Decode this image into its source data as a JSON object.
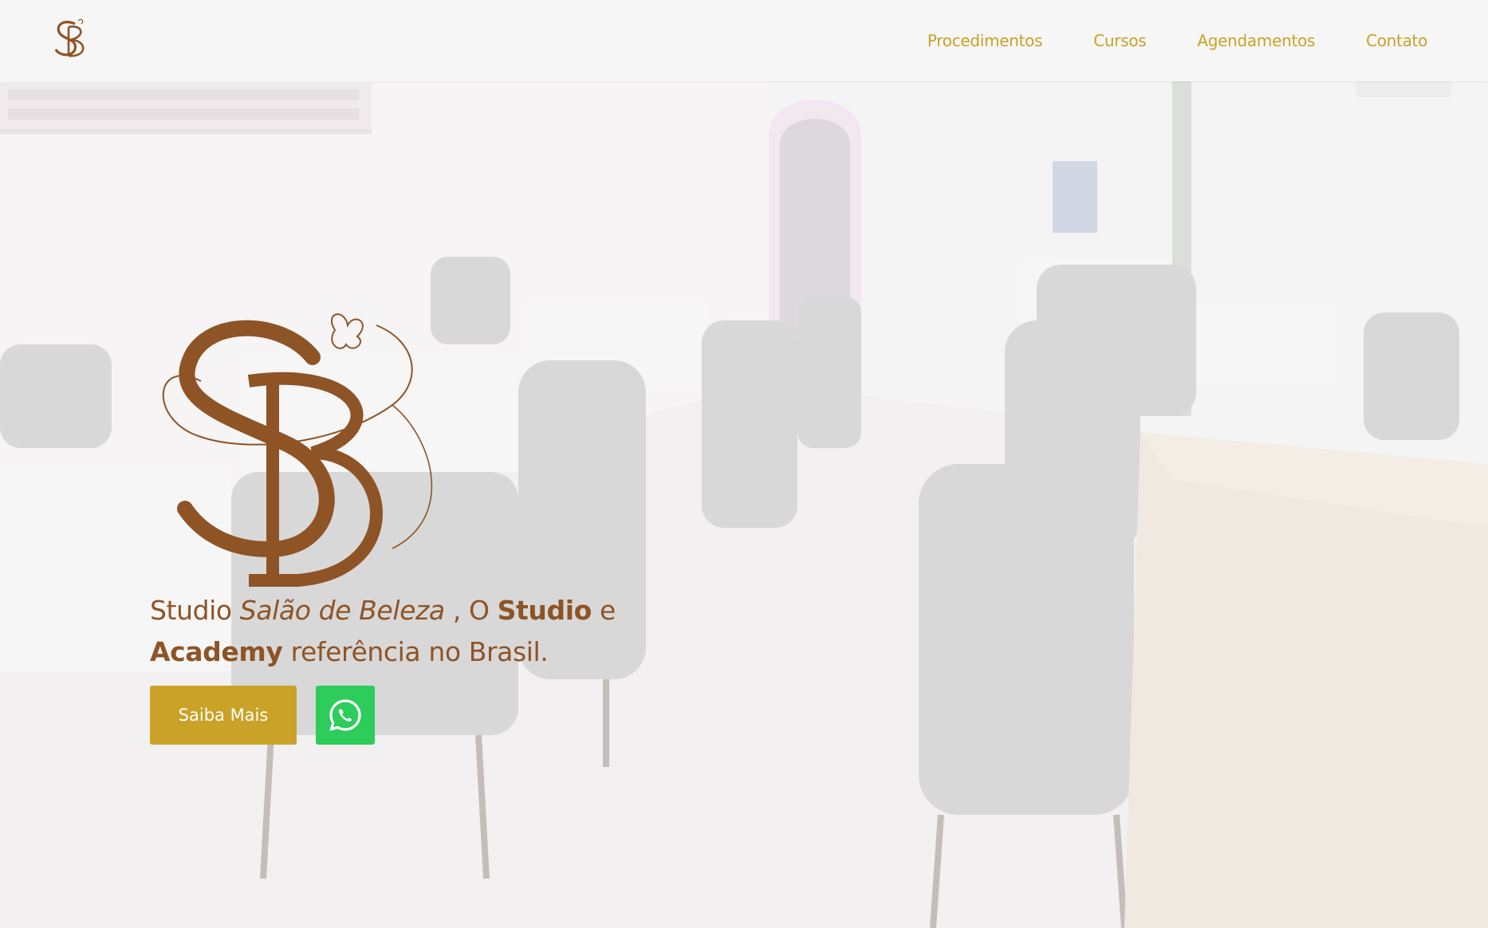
{
  "header": {
    "logo_icon": "sb-monogram-icon",
    "nav": [
      {
        "label": "Procedimentos"
      },
      {
        "label": "Cursos"
      },
      {
        "label": "Agendamentos"
      },
      {
        "label": "Contato"
      }
    ]
  },
  "hero": {
    "logo_icon": "sb-monogram-butterfly-logo",
    "tagline": {
      "part1": "Studio ",
      "italic": "Salão de Beleza",
      "part2": " , O ",
      "bold1": "Studio",
      "part3": " e ",
      "bold2": "Academy",
      "part4": " referência no Brasil."
    },
    "cta_label": "Saiba Mais",
    "whatsapp_icon": "whatsapp-icon"
  },
  "colors": {
    "accent_gold": "#c9a227",
    "brand_brown": "#8e5426",
    "whatsapp_green": "#2ecc5b",
    "header_bg": "#f6f6f6"
  }
}
